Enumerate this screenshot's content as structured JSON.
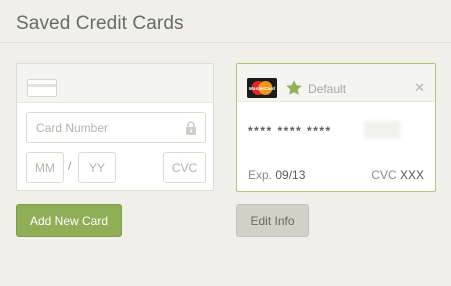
{
  "page": {
    "title": "Saved Credit Cards"
  },
  "new_card": {
    "card_number_placeholder": "Card Number",
    "month_placeholder": "MM",
    "separator": "/",
    "year_placeholder": "YY",
    "cvc_placeholder": "CVC",
    "add_button_label": "Add New Card"
  },
  "saved_card": {
    "brand_icon": "mastercard-logo",
    "brand_logo_text": "MasterCard",
    "default_label": "Default",
    "masked_number": "**** **** ****",
    "exp_label": "Exp.",
    "exp_value": "09/13",
    "cvc_label": "CVC",
    "cvc_value": "XXX",
    "edit_button_label": "Edit Info"
  },
  "colors": {
    "accent_green": "#8fae55",
    "selected_border": "#b3c57e",
    "background": "#f0efea"
  }
}
